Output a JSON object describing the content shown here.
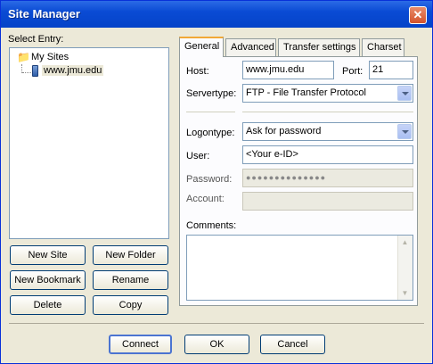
{
  "window": {
    "title": "Site Manager"
  },
  "tree": {
    "heading": "Select Entry:",
    "root": "My Sites",
    "site": "www.jmu.edu"
  },
  "left_buttons": {
    "new_site": "New Site",
    "new_folder": "New Folder",
    "new_bookmark": "New Bookmark",
    "rename": "Rename",
    "delete": "Delete",
    "copy": "Copy"
  },
  "tabs": [
    "General",
    "Advanced",
    "Transfer settings",
    "Charset"
  ],
  "general": {
    "host_label": "Host:",
    "host_value": "www.jmu.edu",
    "port_label": "Port:",
    "port_value": "21",
    "servertype_label": "Servertype:",
    "servertype_value": "FTP - File Transfer Protocol",
    "logontype_label": "Logontype:",
    "logontype_value": "Ask for password",
    "user_label": "User:",
    "user_value": "<Your e-ID>",
    "password_label": "Password:",
    "password_value": "●●●●●●●●●●●●●●",
    "account_label": "Account:",
    "account_value": "",
    "comments_label": "Comments:",
    "comments_value": ""
  },
  "footer": {
    "connect": "Connect",
    "ok": "OK",
    "cancel": "Cancel"
  }
}
